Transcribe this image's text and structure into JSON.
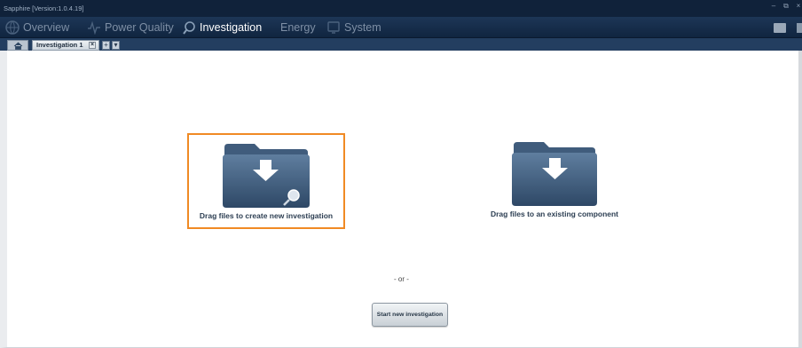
{
  "app": {
    "title": "Sapphire [Version:1.0.4.19]"
  },
  "nav": {
    "items": [
      {
        "label": "Overview",
        "icon": "globe-icon",
        "active": false
      },
      {
        "label": "Power Quality",
        "icon": "waveform-icon",
        "active": false
      },
      {
        "label": "Investigation",
        "icon": "magnifier-icon",
        "active": true
      },
      {
        "label": "Energy",
        "icon": "",
        "active": false
      },
      {
        "label": "System",
        "icon": "monitor-icon",
        "active": false
      }
    ],
    "right_icons": [
      "folder-icon",
      "settings-icon"
    ]
  },
  "tabs": {
    "home_icon": "home-icon",
    "items": [
      {
        "label": "Investigation 1",
        "close": "×"
      }
    ],
    "buttons": [
      "+",
      "▾"
    ]
  },
  "main": {
    "dropzone_new": {
      "label": "Drag files to create new investigation",
      "icon": "folder-download-search-icon",
      "highlighted": true
    },
    "dropzone_existing": {
      "label": "Drag files to an existing component",
      "icon": "folder-download-icon"
    },
    "separator": "- or -",
    "start_button": "Start new investigation"
  },
  "colors": {
    "accent_highlight": "#f08a24",
    "nav_background": "#10223a",
    "folder": "#3d5a7a"
  }
}
